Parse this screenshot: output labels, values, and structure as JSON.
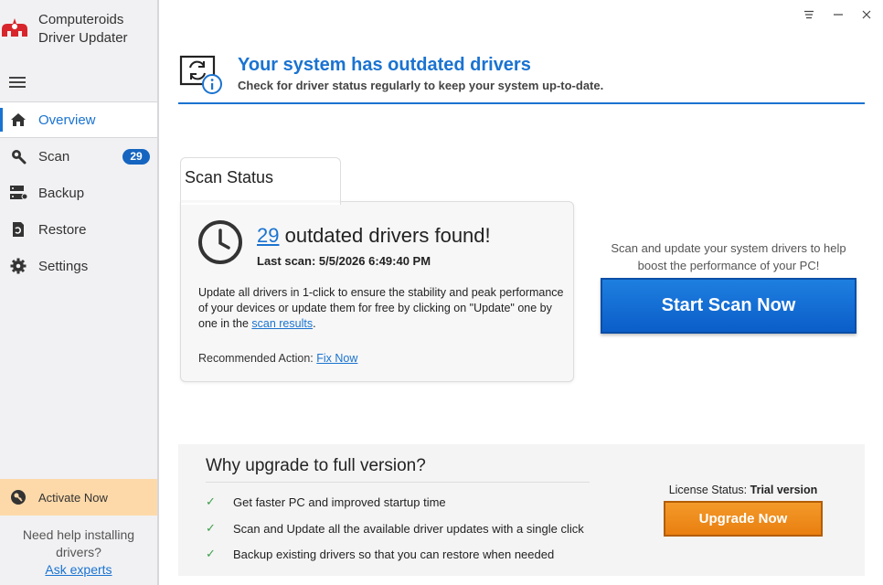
{
  "app": {
    "name_line1": "Computeroids",
    "name_line2": "Driver Updater"
  },
  "sidebar": {
    "items": [
      {
        "label": "Overview",
        "icon": "home-icon",
        "active": true
      },
      {
        "label": "Scan",
        "icon": "search-icon",
        "badge": "29"
      },
      {
        "label": "Backup",
        "icon": "backup-icon"
      },
      {
        "label": "Restore",
        "icon": "restore-icon"
      },
      {
        "label": "Settings",
        "icon": "gear-icon"
      }
    ],
    "activate_label": "Activate Now",
    "help_text_1": "Need help installing",
    "help_text_2": "drivers?",
    "help_link": "Ask experts"
  },
  "header": {
    "title": "Your system has outdated drivers",
    "subtitle": "Check for driver status regularly to keep your system up-to-date."
  },
  "scan_status": {
    "tab_label": "Scan Status",
    "count": "29",
    "found_suffix": " outdated drivers found!",
    "last_scan": "Last scan: 5/5/2026 6:49:40 PM",
    "desc_part1": "Update all drivers in 1-click to ensure the stability and peak performance of your devices or update them for free by clicking on \"Update\" one by one in the ",
    "desc_link": "scan results",
    "desc_end": ".",
    "recommend_label": "Recommended Action: ",
    "recommend_link": "Fix Now"
  },
  "cta": {
    "text": "Scan and update your system drivers to help boost the performance of your PC!",
    "button": "Start Scan Now"
  },
  "upgrade": {
    "title": "Why upgrade to full version?",
    "features": [
      "Get faster PC and improved startup time",
      "Scan and Update all the available driver updates with a single click",
      "Backup existing drivers so that you can restore when needed"
    ],
    "license_label": "License Status: ",
    "license_value": "Trial version",
    "button": "Upgrade Now"
  },
  "colors": {
    "accent": "#1a73d1",
    "orange": "#ef8a1c",
    "check": "#3ca04b",
    "brand_red": "#d7252b"
  }
}
